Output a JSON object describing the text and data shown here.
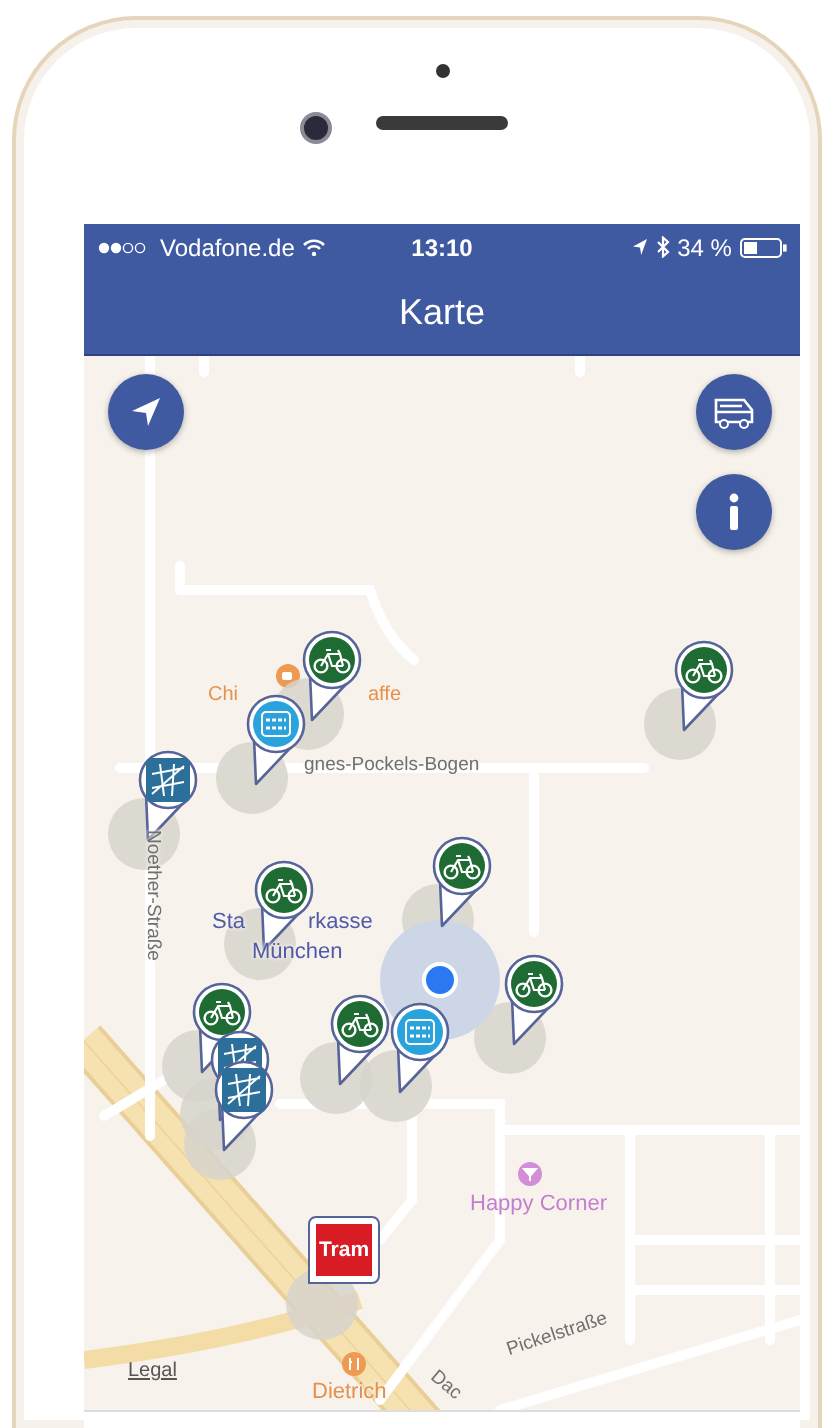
{
  "status_bar": {
    "carrier": "Vodafone.de",
    "time": "13:10",
    "battery": "34 %"
  },
  "nav_bar": {
    "title": "Karte"
  },
  "map": {
    "labels": [
      {
        "kind": "cafe",
        "text": "Chi"
      },
      {
        "kind": "cafe",
        "text": "affe"
      },
      {
        "kind": "street",
        "text": "gnes-Pockels-Bogen"
      },
      {
        "kind": "street",
        "text": "Noether-Straße"
      },
      {
        "kind": "bank",
        "text": "Sta"
      },
      {
        "kind": "bank",
        "text": "rkasse"
      },
      {
        "kind": "bank",
        "text": "München"
      },
      {
        "kind": "bar",
        "text": "Happy Corner"
      },
      {
        "kind": "restaurant",
        "text": "Dietrich"
      },
      {
        "kind": "street",
        "text": "Dac"
      },
      {
        "kind": "street",
        "text": "Pickelstraße"
      }
    ],
    "pins": [
      {
        "kind": "bike"
      },
      {
        "kind": "carsharing"
      },
      {
        "kind": "transit"
      },
      {
        "kind": "bike"
      },
      {
        "kind": "bike"
      },
      {
        "kind": "bike"
      },
      {
        "kind": "bike"
      },
      {
        "kind": "bike"
      },
      {
        "kind": "transit"
      },
      {
        "kind": "transit"
      },
      {
        "kind": "bike"
      },
      {
        "kind": "carsharing"
      },
      {
        "kind": "tram",
        "label": "Tram"
      }
    ],
    "legal": "Legal"
  }
}
